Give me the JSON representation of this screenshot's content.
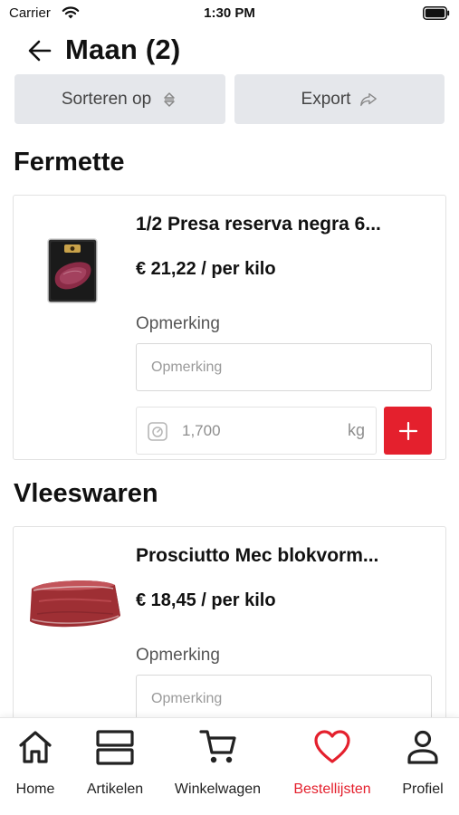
{
  "status_bar": {
    "carrier": "Carrier",
    "time": "1:30 PM"
  },
  "header": {
    "title": "Maan (2)"
  },
  "actions": {
    "sort_label": "Sorteren op",
    "export_label": "Export"
  },
  "sections": [
    {
      "title": "Fermette",
      "product": {
        "name": "1/2 Presa reserva negra 6...",
        "price": "€ 21,22 / per kilo",
        "remark_label": "Opmerking",
        "remark_placeholder": "Opmerking",
        "quantity": "1,700",
        "unit": "kg"
      }
    },
    {
      "title": "Vleeswaren",
      "product": {
        "name": "Prosciutto Mec blokvorm...",
        "price": "€ 18,45 / per kilo",
        "remark_label": "Opmerking",
        "remark_placeholder": "Opmerking"
      }
    }
  ],
  "tabs": [
    {
      "label": "Home",
      "icon": "home-icon",
      "active": false
    },
    {
      "label": "Artikelen",
      "icon": "grid-icon",
      "active": false
    },
    {
      "label": "Winkelwagen",
      "icon": "cart-icon",
      "active": false
    },
    {
      "label": "Bestellijsten",
      "icon": "heart-icon",
      "active": true
    },
    {
      "label": "Profiel",
      "icon": "user-icon",
      "active": false
    }
  ],
  "colors": {
    "accent": "#e4202d",
    "button_bg": "#e5e7eb"
  }
}
